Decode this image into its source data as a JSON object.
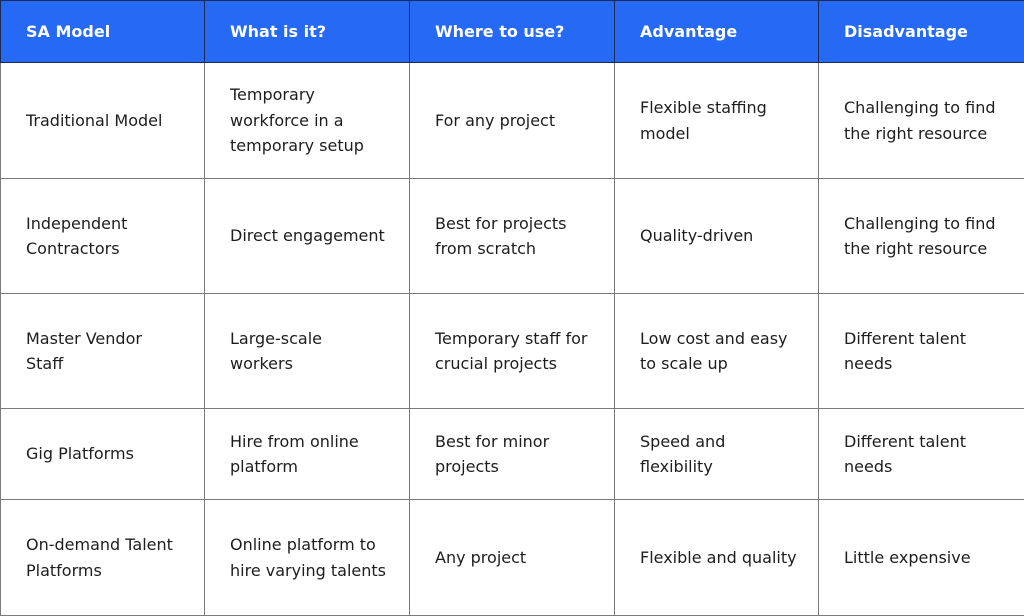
{
  "colors": {
    "header_bg": "#2669f5",
    "header_text": "#ffffff",
    "cell_text": "#1d1d1d",
    "grid": "#7a7a7a"
  },
  "table": {
    "headers": [
      "SA Model",
      "What is it?",
      "Where to use?",
      "Advantage",
      "Disadvantage"
    ],
    "rows": [
      [
        "Traditional Model",
        "Temporary workforce in a temporary setup",
        "For any project",
        "Flexible staffing model",
        "Challenging to find the right resource"
      ],
      [
        "Independent Contractors",
        "Direct engagement",
        "Best for projects from scratch",
        "Quality-driven",
        "Challenging to find the right resource"
      ],
      [
        "Master Vendor Staff",
        "Large-scale workers",
        "Temporary staff for crucial projects",
        "Low cost and easy to scale up",
        "Different talent needs"
      ],
      [
        "Gig Platforms",
        "Hire from online platform",
        "Best for minor projects",
        "Speed and flexibility",
        "Different talent needs"
      ],
      [
        "On-demand Talent Platforms",
        "Online platform to hire varying talents",
        "Any project",
        "Flexible and quality",
        "Little expensive"
      ]
    ]
  }
}
